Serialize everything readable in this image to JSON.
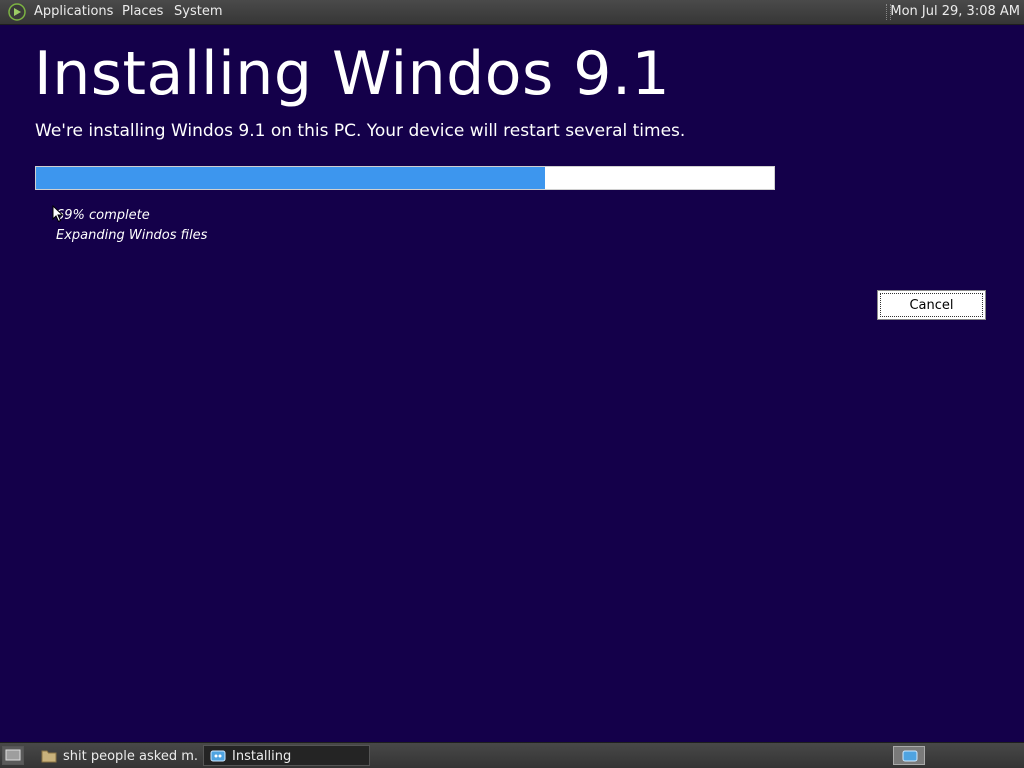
{
  "top_panel": {
    "menus": [
      "Applications",
      "Places",
      "System"
    ],
    "clock": "Mon Jul 29,  3:08 AM"
  },
  "installer": {
    "title": "Installing Windos 9.1",
    "subtitle": "We're installing Windos 9.1 on this PC. Your device will restart several times.",
    "progress_fraction": 0.69,
    "percent_text": "69% complete",
    "status_text": "Expanding Windos files",
    "cancel_label": "Cancel",
    "colors": {
      "background": "#14004a",
      "progress": "#3d96ee"
    }
  },
  "taskbar": {
    "tasks": [
      {
        "label": "shit people asked m...",
        "icon": "folder-icon",
        "active": false
      },
      {
        "label": "Installing",
        "icon": "app-window-icon",
        "active": true
      }
    ]
  }
}
